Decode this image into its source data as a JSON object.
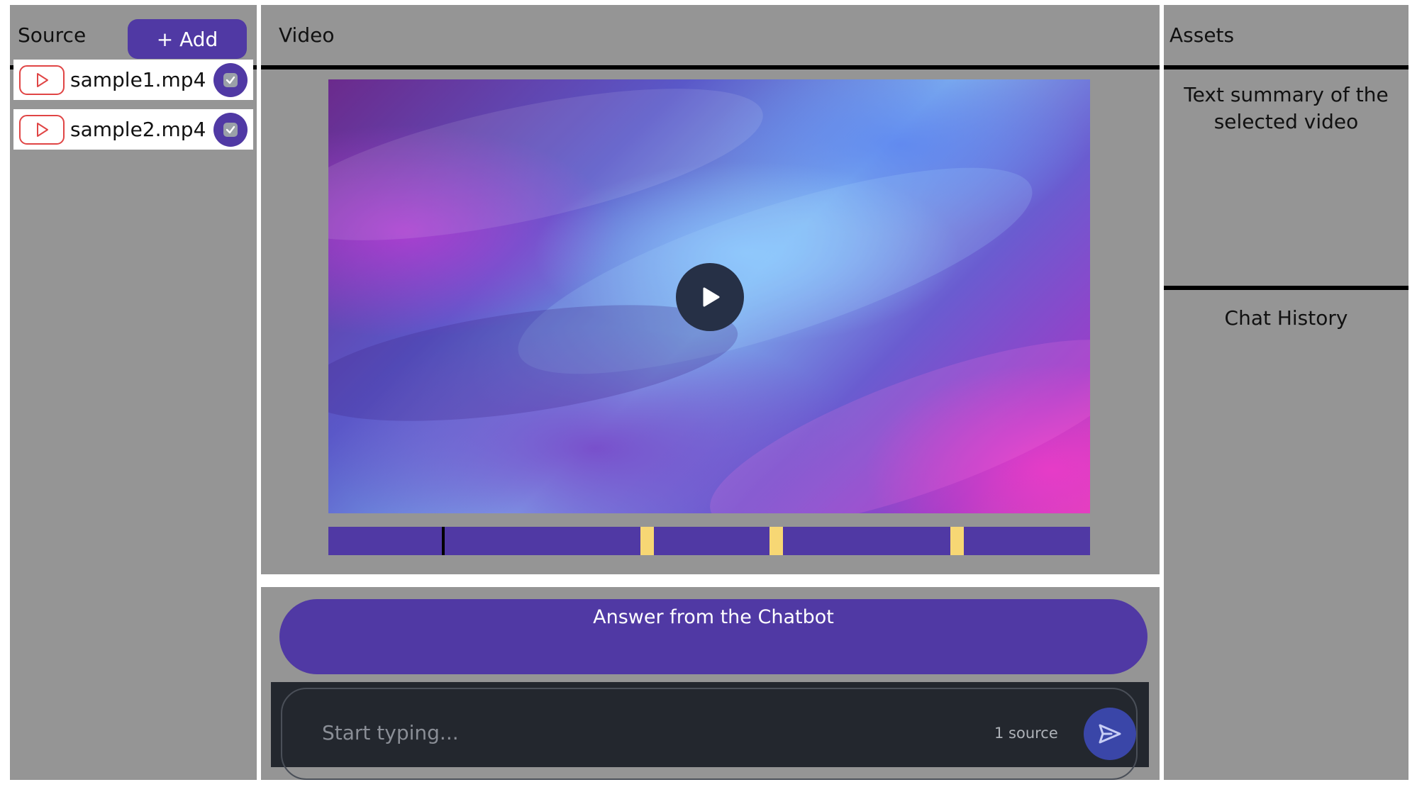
{
  "source_panel": {
    "title": "Source",
    "add_label": "+ Add",
    "files": [
      {
        "name": "sample1.mp4",
        "checked": true
      },
      {
        "name": "sample2.mp4",
        "checked": true
      }
    ]
  },
  "video_panel": {
    "title": "Video"
  },
  "chat_panel": {
    "answer_text": "Answer from the Chatbot",
    "input_placeholder": "Start typing...",
    "source_count": "1 source"
  },
  "assets_panel": {
    "title": "Assets",
    "summary_text": "Text summary of the selected video",
    "history_title": "Chat History"
  },
  "colors": {
    "accent": "#5039a4",
    "panel_bg": "#959595",
    "timeline_highlight": "#f7d774",
    "input_bg": "#23272e"
  }
}
